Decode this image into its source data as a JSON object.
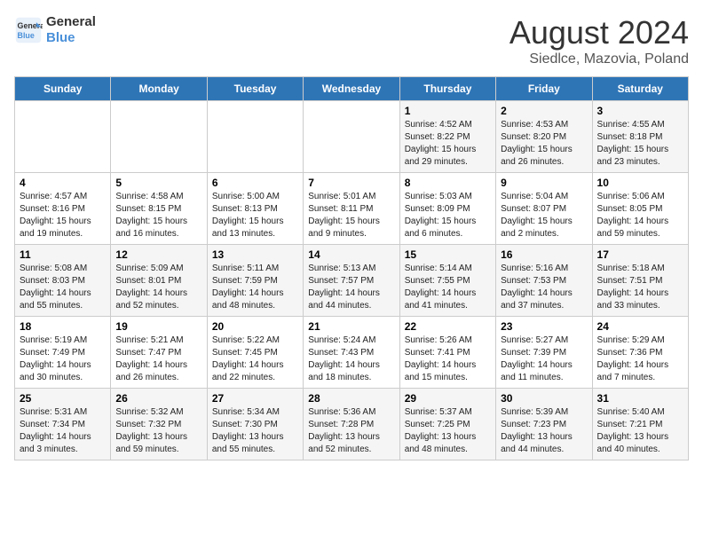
{
  "logo": {
    "line1": "General",
    "line2": "Blue"
  },
  "title": "August 2024",
  "subtitle": "Siedlce, Mazovia, Poland",
  "weekdays": [
    "Sunday",
    "Monday",
    "Tuesday",
    "Wednesday",
    "Thursday",
    "Friday",
    "Saturday"
  ],
  "weeks": [
    [
      {
        "day": "",
        "info": ""
      },
      {
        "day": "",
        "info": ""
      },
      {
        "day": "",
        "info": ""
      },
      {
        "day": "",
        "info": ""
      },
      {
        "day": "1",
        "info": "Sunrise: 4:52 AM\nSunset: 8:22 PM\nDaylight: 15 hours\nand 29 minutes."
      },
      {
        "day": "2",
        "info": "Sunrise: 4:53 AM\nSunset: 8:20 PM\nDaylight: 15 hours\nand 26 minutes."
      },
      {
        "day": "3",
        "info": "Sunrise: 4:55 AM\nSunset: 8:18 PM\nDaylight: 15 hours\nand 23 minutes."
      }
    ],
    [
      {
        "day": "4",
        "info": "Sunrise: 4:57 AM\nSunset: 8:16 PM\nDaylight: 15 hours\nand 19 minutes."
      },
      {
        "day": "5",
        "info": "Sunrise: 4:58 AM\nSunset: 8:15 PM\nDaylight: 15 hours\nand 16 minutes."
      },
      {
        "day": "6",
        "info": "Sunrise: 5:00 AM\nSunset: 8:13 PM\nDaylight: 15 hours\nand 13 minutes."
      },
      {
        "day": "7",
        "info": "Sunrise: 5:01 AM\nSunset: 8:11 PM\nDaylight: 15 hours\nand 9 minutes."
      },
      {
        "day": "8",
        "info": "Sunrise: 5:03 AM\nSunset: 8:09 PM\nDaylight: 15 hours\nand 6 minutes."
      },
      {
        "day": "9",
        "info": "Sunrise: 5:04 AM\nSunset: 8:07 PM\nDaylight: 15 hours\nand 2 minutes."
      },
      {
        "day": "10",
        "info": "Sunrise: 5:06 AM\nSunset: 8:05 PM\nDaylight: 14 hours\nand 59 minutes."
      }
    ],
    [
      {
        "day": "11",
        "info": "Sunrise: 5:08 AM\nSunset: 8:03 PM\nDaylight: 14 hours\nand 55 minutes."
      },
      {
        "day": "12",
        "info": "Sunrise: 5:09 AM\nSunset: 8:01 PM\nDaylight: 14 hours\nand 52 minutes."
      },
      {
        "day": "13",
        "info": "Sunrise: 5:11 AM\nSunset: 7:59 PM\nDaylight: 14 hours\nand 48 minutes."
      },
      {
        "day": "14",
        "info": "Sunrise: 5:13 AM\nSunset: 7:57 PM\nDaylight: 14 hours\nand 44 minutes."
      },
      {
        "day": "15",
        "info": "Sunrise: 5:14 AM\nSunset: 7:55 PM\nDaylight: 14 hours\nand 41 minutes."
      },
      {
        "day": "16",
        "info": "Sunrise: 5:16 AM\nSunset: 7:53 PM\nDaylight: 14 hours\nand 37 minutes."
      },
      {
        "day": "17",
        "info": "Sunrise: 5:18 AM\nSunset: 7:51 PM\nDaylight: 14 hours\nand 33 minutes."
      }
    ],
    [
      {
        "day": "18",
        "info": "Sunrise: 5:19 AM\nSunset: 7:49 PM\nDaylight: 14 hours\nand 30 minutes."
      },
      {
        "day": "19",
        "info": "Sunrise: 5:21 AM\nSunset: 7:47 PM\nDaylight: 14 hours\nand 26 minutes."
      },
      {
        "day": "20",
        "info": "Sunrise: 5:22 AM\nSunset: 7:45 PM\nDaylight: 14 hours\nand 22 minutes."
      },
      {
        "day": "21",
        "info": "Sunrise: 5:24 AM\nSunset: 7:43 PM\nDaylight: 14 hours\nand 18 minutes."
      },
      {
        "day": "22",
        "info": "Sunrise: 5:26 AM\nSunset: 7:41 PM\nDaylight: 14 hours\nand 15 minutes."
      },
      {
        "day": "23",
        "info": "Sunrise: 5:27 AM\nSunset: 7:39 PM\nDaylight: 14 hours\nand 11 minutes."
      },
      {
        "day": "24",
        "info": "Sunrise: 5:29 AM\nSunset: 7:36 PM\nDaylight: 14 hours\nand 7 minutes."
      }
    ],
    [
      {
        "day": "25",
        "info": "Sunrise: 5:31 AM\nSunset: 7:34 PM\nDaylight: 14 hours\nand 3 minutes."
      },
      {
        "day": "26",
        "info": "Sunrise: 5:32 AM\nSunset: 7:32 PM\nDaylight: 13 hours\nand 59 minutes."
      },
      {
        "day": "27",
        "info": "Sunrise: 5:34 AM\nSunset: 7:30 PM\nDaylight: 13 hours\nand 55 minutes."
      },
      {
        "day": "28",
        "info": "Sunrise: 5:36 AM\nSunset: 7:28 PM\nDaylight: 13 hours\nand 52 minutes."
      },
      {
        "day": "29",
        "info": "Sunrise: 5:37 AM\nSunset: 7:25 PM\nDaylight: 13 hours\nand 48 minutes."
      },
      {
        "day": "30",
        "info": "Sunrise: 5:39 AM\nSunset: 7:23 PM\nDaylight: 13 hours\nand 44 minutes."
      },
      {
        "day": "31",
        "info": "Sunrise: 5:40 AM\nSunset: 7:21 PM\nDaylight: 13 hours\nand 40 minutes."
      }
    ]
  ]
}
